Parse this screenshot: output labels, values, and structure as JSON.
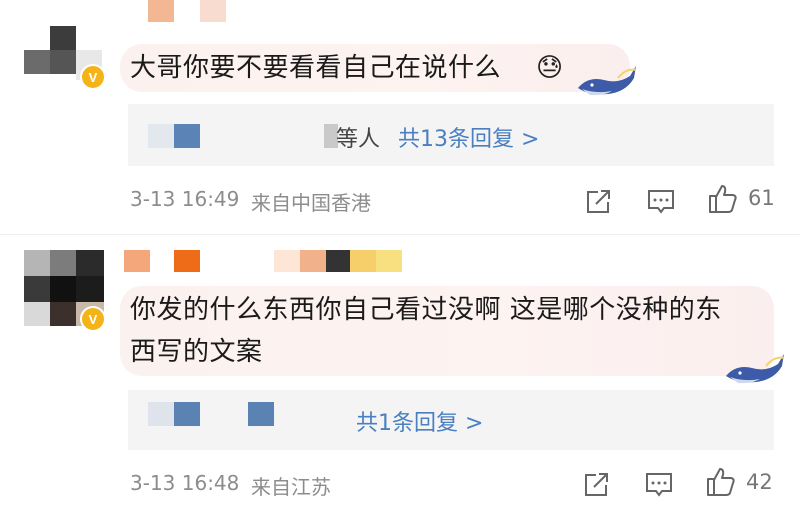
{
  "comments": [
    {
      "text": "大哥你要不要看看自己在说什么",
      "emoji": "😓",
      "replies": {
        "prefix": "等人",
        "link": "共13条回复 >"
      },
      "timestamp": "3-13 16:49",
      "location": "来自中国香港",
      "like_count": "61"
    },
    {
      "text_line1": "你发的什么东西你自己看过没啊 这是哪个没种的东",
      "text_line2": "西写的文案",
      "replies": {
        "link": "共1条回复 >"
      },
      "timestamp": "3-13 16:48",
      "location": "来自江苏",
      "like_count": "42"
    }
  ],
  "icons": {
    "share": "share-icon",
    "comment": "comment-icon",
    "like": "thumbs-up-icon",
    "verified": "verified-badge-icon",
    "whale": "whale-bubble-decoration"
  },
  "colors": {
    "link": "#4a7fc1",
    "meta": "#8c8c8c",
    "badge": "#f5b31a",
    "bubble": "#fbf1ef",
    "replies_bg": "#f4f4f4"
  }
}
